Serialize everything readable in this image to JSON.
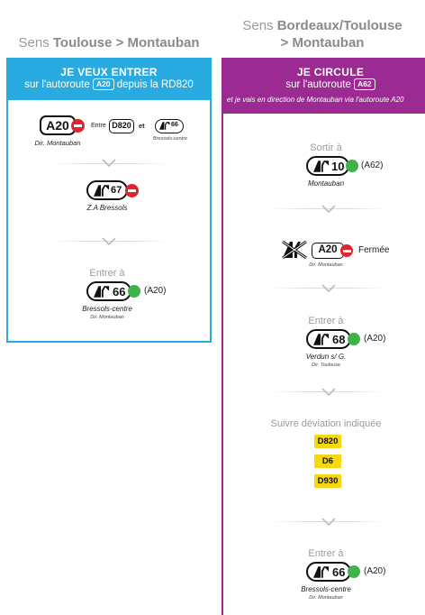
{
  "left": {
    "heading_prefix": "Sens ",
    "heading_bold": "Toulouse > Montauban",
    "banner": {
      "title": "JE VEUX ENTRER",
      "line_pre": "sur l'autoroute",
      "tag": "A20",
      "line_post": "depuis la RD820"
    },
    "step1": {
      "road": "A20",
      "road_caption": "Dir. Montauban",
      "between_word": "Entre",
      "road2": "D820",
      "and_word": "et",
      "exit_num": "66",
      "exit_caption": "Bressols-centre"
    },
    "step2": {
      "exit_num": "67",
      "caption": "Z.A Bressols"
    },
    "step3": {
      "label": "Entrer à",
      "exit_num": "66",
      "road_ref": "(A20)",
      "caption": "Bressols-centre",
      "sub_caption": "Dir. Montauban"
    }
  },
  "right": {
    "heading_prefix": "Sens ",
    "heading_bold_1": "Bordeaux/Toulouse",
    "heading_bold_2": "> Montauban",
    "banner": {
      "title": "JE CIRCULE",
      "line_pre": "sur l'autoroute",
      "tag": "A62",
      "line_italic": "et je vais en direction de Montauban via l'autoroute A20"
    },
    "step1": {
      "label": "Sortir à",
      "exit_num": "10",
      "road_ref": "(A62)",
      "caption": "Montauban"
    },
    "step2": {
      "road": "A20",
      "status": "Fermée",
      "caption": "Dir. Montauban"
    },
    "step3": {
      "label": "Entrer à",
      "exit_num": "68",
      "road_ref": "(A20)",
      "caption": "Verdun s/ G.",
      "sub_caption": "Dir. Toulouse"
    },
    "step4": {
      "label": "Suivre déviation indiquée",
      "roads": [
        "D820",
        "D6",
        "D930"
      ]
    },
    "step5": {
      "label": "Entrer à",
      "exit_num": "66",
      "road_ref": "(A20)",
      "caption": "Bressols-centre",
      "sub_caption": "Dir. Montauban"
    }
  },
  "colors": {
    "left_accent": "#29abe2",
    "right_accent": "#9b2a93",
    "closed_red": "#e4222b",
    "open_green": "#3fb34a",
    "deviation_yellow": "#f6d80f"
  },
  "icons": [
    "exit-icon",
    "no-entry-icon",
    "open-dot-icon",
    "chevron-down-icon",
    "closed-interchange-icon"
  ]
}
